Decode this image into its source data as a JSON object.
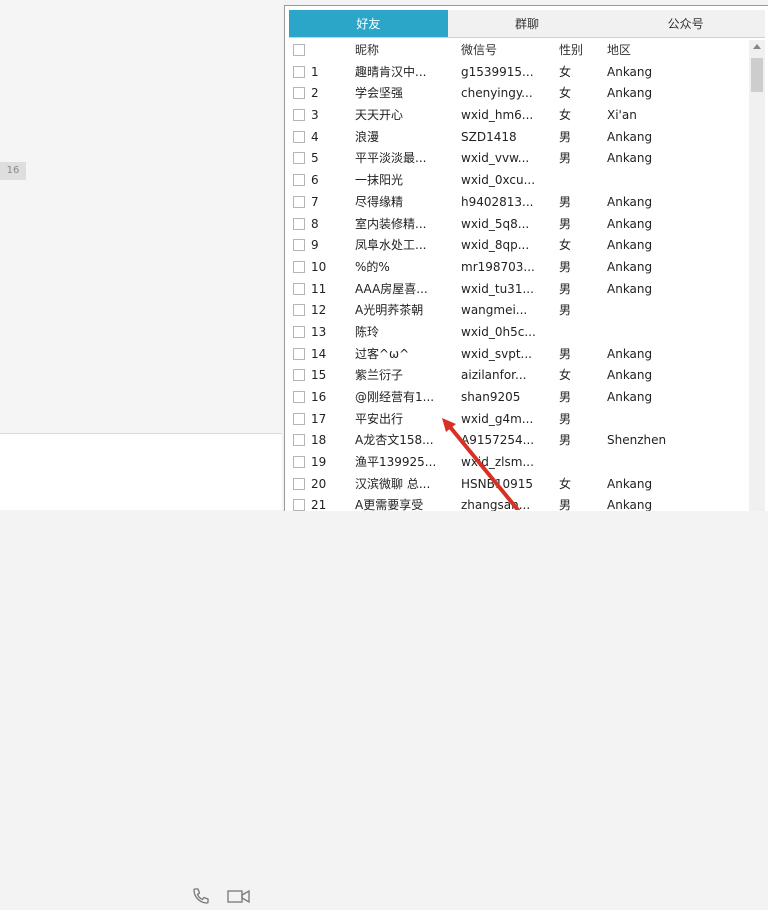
{
  "left": {
    "badge": "16"
  },
  "tabs": [
    {
      "label": "好友"
    },
    {
      "label": "群聊"
    },
    {
      "label": "公众号"
    }
  ],
  "table": {
    "headers": {
      "nick": "昵称",
      "wx": "微信号",
      "sex": "性别",
      "region": "地区"
    },
    "rows": [
      {
        "n": "1",
        "nick": "趣晴肯汉中...",
        "wx": "g1539915...",
        "sex": "女",
        "region": "Ankang"
      },
      {
        "n": "2",
        "nick": "学会坚强",
        "wx": "chenyingy...",
        "sex": "女",
        "region": "Ankang"
      },
      {
        "n": "3",
        "nick": "天天开心",
        "wx": "wxid_hm6...",
        "sex": "女",
        "region": "Xi'an"
      },
      {
        "n": "4",
        "nick": "浪漫",
        "wx": "SZD1418",
        "sex": "男",
        "region": "Ankang"
      },
      {
        "n": "5",
        "nick": "平平淡淡最...",
        "wx": "wxid_vvw...",
        "sex": "男",
        "region": "Ankang"
      },
      {
        "n": "6",
        "nick": "一抹阳光",
        "wx": "wxid_0xcu...",
        "sex": "",
        "region": ""
      },
      {
        "n": "7",
        "nick": "  尽得缘精",
        "wx": "h9402813...",
        "sex": "男",
        "region": "Ankang"
      },
      {
        "n": "8",
        "nick": "室内装修精...",
        "wx": "wxid_5q8...",
        "sex": "男",
        "region": "Ankang"
      },
      {
        "n": "9",
        "nick": "凤阜水处工...",
        "wx": "wxid_8qp...",
        "sex": "女",
        "region": "Ankang"
      },
      {
        "n": "10",
        "nick": "%的%",
        "wx": "mr198703...",
        "sex": "男",
        "region": "Ankang"
      },
      {
        "n": "11",
        "nick": "AAA房屋喜...",
        "wx": "wxid_tu31...",
        "sex": "男",
        "region": "Ankang"
      },
      {
        "n": "12",
        "nick": "A光明荞茶朝",
        "wx": "wangmei...",
        "sex": "男",
        "region": ""
      },
      {
        "n": "13",
        "nick": "陈玲",
        "wx": "wxid_0h5c...",
        "sex": "",
        "region": ""
      },
      {
        "n": "14",
        "nick": "过客^ω^",
        "wx": "wxid_svpt...",
        "sex": "男",
        "region": "Ankang"
      },
      {
        "n": "15",
        "nick": "   紫兰衍子",
        "wx": "aizilanfor...",
        "sex": "女",
        "region": "Ankang"
      },
      {
        "n": "16",
        "nick": "@刚经营有1...",
        "wx": "shan9205",
        "sex": "男",
        "region": "Ankang"
      },
      {
        "n": "17",
        "nick": "平安出行",
        "wx": "wxid_g4m...",
        "sex": "男",
        "region": ""
      },
      {
        "n": "18",
        "nick": "A龙杏文158...",
        "wx": "A9157254...",
        "sex": "男",
        "region": "Shenzhen"
      },
      {
        "n": "19",
        "nick": "渔平139925...",
        "wx": "wxid_zlsm...",
        "sex": "",
        "region": ""
      },
      {
        "n": "20",
        "nick": "汉滨微聊 总...",
        "wx": "HSNB10915",
        "sex": "女",
        "region": "Ankang"
      },
      {
        "n": "21",
        "nick": "A更需要享受",
        "wx": "zhangsan...",
        "sex": "男",
        "region": "Ankang"
      }
    ]
  },
  "colors": {
    "active_tab": "#2ba6c9",
    "arrow": "#d93025"
  }
}
